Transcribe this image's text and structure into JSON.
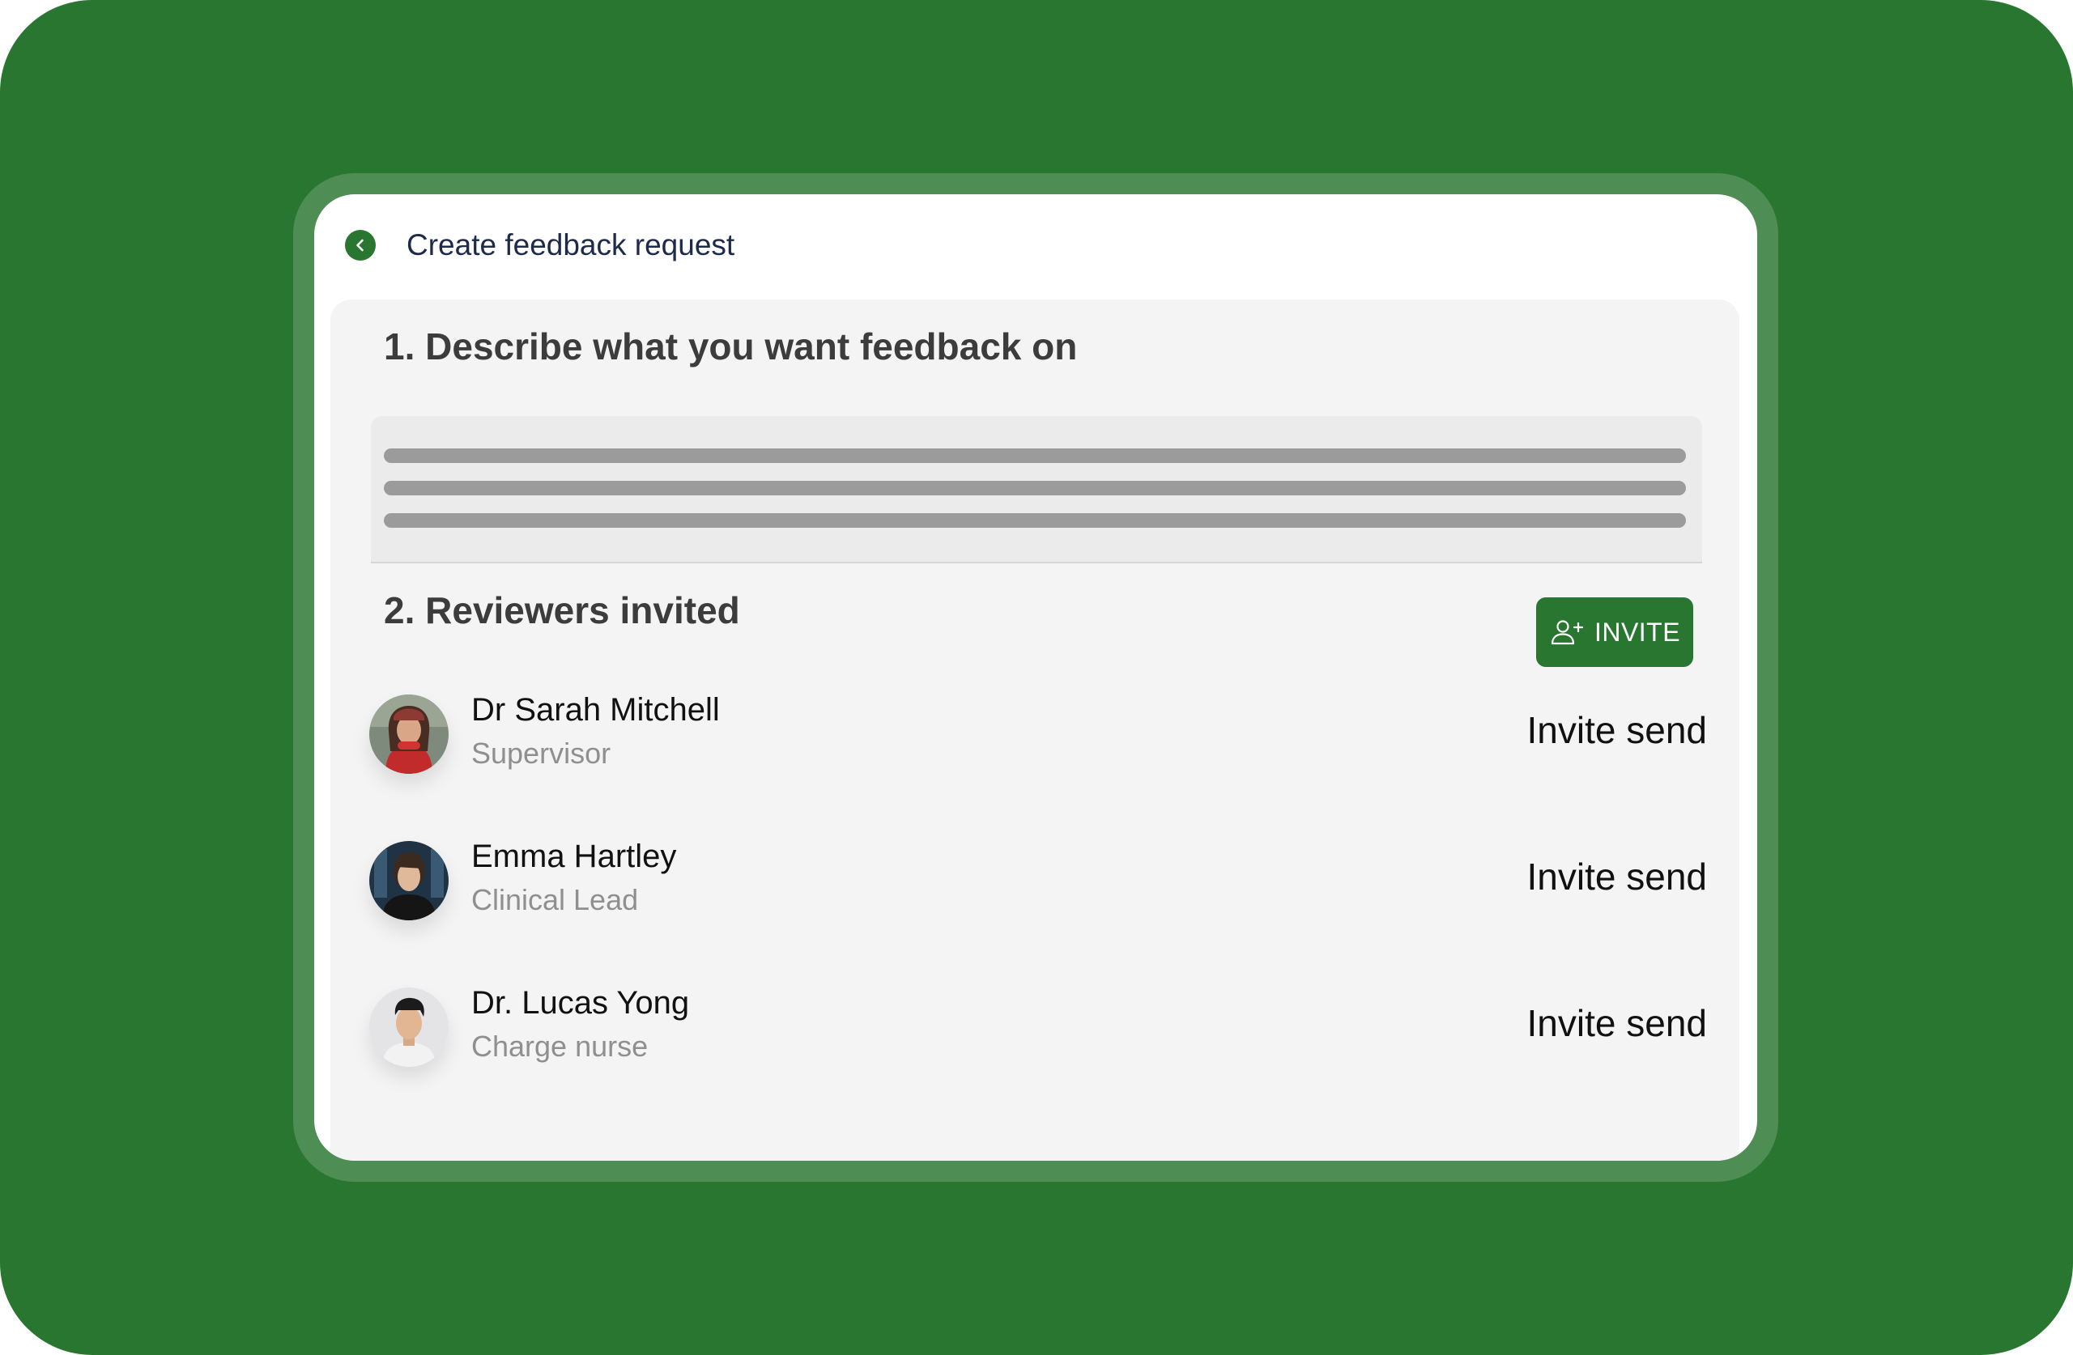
{
  "header": {
    "title": "Create feedback request",
    "back_icon": "chevron-left-icon"
  },
  "section_describe": {
    "title": "1. Describe what you want feedback on",
    "placeholder_line_count": 3
  },
  "section_reviewers": {
    "title": "2. Reviewers invited",
    "invite_button": {
      "label": "INVITE",
      "icon": "add-user-icon"
    },
    "reviewers": [
      {
        "name": "Dr Sarah Mitchell",
        "role": "Supervisor",
        "status": "Invite send"
      },
      {
        "name": "Emma Hartley",
        "role": "Clinical Lead",
        "status": "Invite send"
      },
      {
        "name": "Dr. Lucas Yong",
        "role": "Charge nurse",
        "status": "Invite send"
      }
    ]
  },
  "colors": {
    "brand_green": "#297631",
    "frame_green": "#4e8d53",
    "panel_bg": "#f4f4f4",
    "title_navy": "#1e2a4a",
    "muted_text": "#8f8f8f"
  }
}
